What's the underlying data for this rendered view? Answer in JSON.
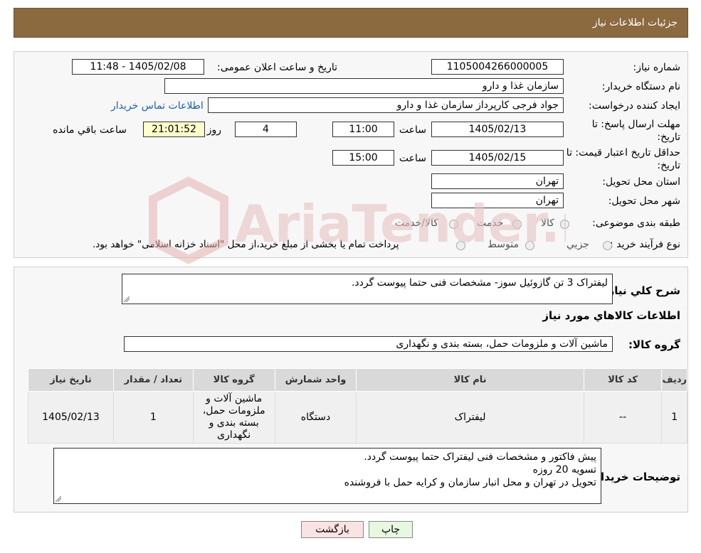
{
  "header": {
    "title": "جزئیات اطلاعات نیاز"
  },
  "form": {
    "need_number_label": "شماره نیاز:",
    "need_number": "1105004266000005",
    "announce_label": "تاریخ و ساعت اعلان عمومی:",
    "announce_value": "1405/02/08 - 11:48",
    "buyer_org_label": "نام دستگاه خریدار:",
    "buyer_org": "سازمان غذا و دارو",
    "creator_label": "ایجاد کننده درخواست:",
    "creator": "جواد فرجی کارپرداز سازمان غذا و دارو",
    "contact_link": "اطلاعات تماس خریدار",
    "deadline_label_1": "مهلت ارسال پاسخ: تا",
    "deadline_label_2": "تاریخ:",
    "deadline_date": "1405/02/13",
    "time_label": "ساعت",
    "deadline_time": "11:00",
    "days_value": "4",
    "days_label": "روز و",
    "remaining_time": "21:01:52",
    "remaining_label": "ساعت باقي مانده",
    "validity_label_1": "حداقل تاریخ اعتبار قیمت: تا",
    "validity_label_2": "تاریخ:",
    "validity_date": "1405/02/15",
    "validity_time_label": "ساعت",
    "validity_time": "15:00",
    "province_label": "استان محل تحویل:",
    "province": "تهران",
    "city_label": "شهر محل تحویل:",
    "city": "تهران",
    "category_label": "طبقه بندی موضوعی:",
    "category_options": [
      "کالا",
      "خدمت",
      "کالا/خدمت"
    ],
    "process_label": "نوع فرآیند خرید :",
    "process_options": [
      "جزیي",
      "متوسط"
    ],
    "process_note": "پرداخت تمام یا بخشی از مبلغ خرید،از محل \"اسناد خزانه اسلامی\" خواهد بود."
  },
  "details": {
    "summary_label": "شرح كلي نياز:",
    "summary": "لیفتراک 3 تن گازوئیل سوز- مشخصات فنی حتما پیوست گردد.",
    "goods_info_title": "اطلاعات كالاهاي مورد نياز",
    "group_label": "گروه کالا:",
    "group_value": "ماشین آلات و ملزومات حمل، بسته بندی و نگهداری",
    "table_headers": [
      "رديف",
      "كد كالا",
      "نام كالا",
      "واحد شمارش",
      "گروه كالا",
      "تعداد / مقدار",
      "تاريخ نياز"
    ],
    "rows": [
      [
        "1",
        "--",
        "لیفتراک",
        "دستگاه",
        "ماشین آلات و ملزومات حمل، بسته بندی و نگهداری",
        "1",
        "1405/02/13"
      ]
    ],
    "buyer_notes_label": "توضیحات خریدار:",
    "buyer_notes": [
      "پیش فاکتور و مشخصات فنی لیفتراک حتما پیوست گردد.",
      "تسویه 20 روزه",
      "تحویل در تهران و محل انبار سازمان و کرایه حمل با فروشنده"
    ]
  },
  "buttons": {
    "print": "چاپ",
    "back": "بازگشت"
  },
  "watermark": {
    "text": "AriaTender.neT"
  },
  "colors": {
    "header": "#8b6a3f",
    "link": "#1a5fb4",
    "watermark": "#e0a3a3"
  }
}
